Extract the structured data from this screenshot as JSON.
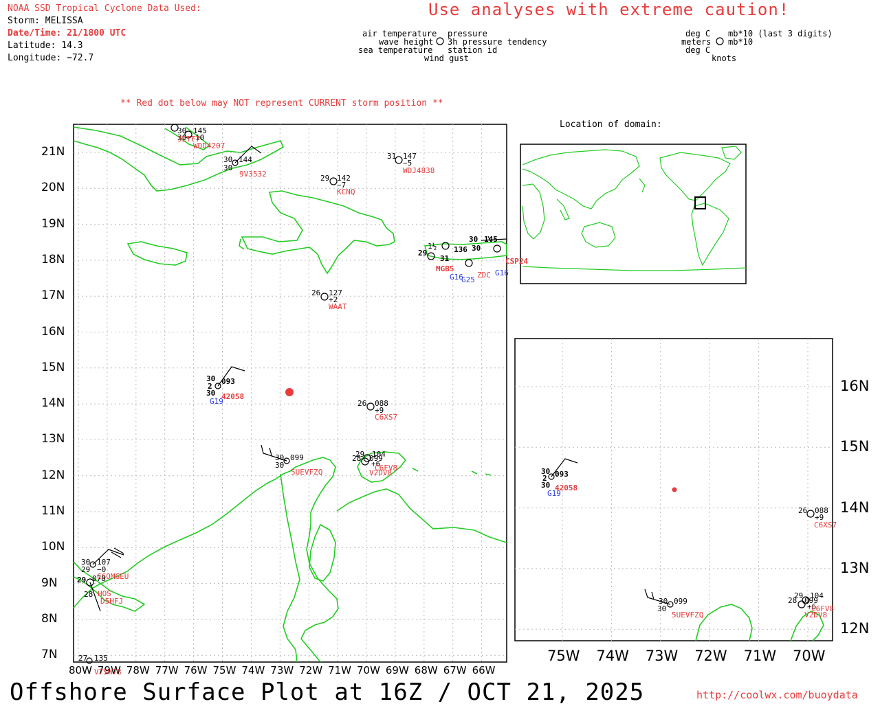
{
  "header": {
    "source": "NOAA SSD Tropical Cyclone Data Used:",
    "storm": "Storm: MELISSA",
    "datetime": "Date/Time: 21/1800 UTC",
    "latitude": "Latitude: 14.3",
    "longitude": "Longitude: −72.7",
    "caution": "Use analyses with extreme caution!",
    "red_dot_note": "** Red dot below may NOT represent CURRENT storm position **"
  },
  "legend": {
    "left": {
      "air_temperature": "air temperature",
      "wave_height": "wave height",
      "sea_temperature": "sea temperature",
      "pressure": "pressure",
      "tendency": "3h pressure tendency",
      "station_id": "station id",
      "wind_gust": "wind gust"
    },
    "right": {
      "deg_c_1": "deg C",
      "meters": "meters",
      "deg_c_2": "deg C",
      "mb1": "mb*10 (last 3 digits)",
      "mb2": "mb*10",
      "knots": "knots"
    }
  },
  "inset": {
    "title": "Location of domain:"
  },
  "main_map": {
    "lat_labels": [
      "21N",
      "20N",
      "19N",
      "18N",
      "17N",
      "16N",
      "15N",
      "14N",
      "13N",
      "12N",
      "11N",
      "10N",
      "9N",
      "8N",
      "7N"
    ],
    "lon_labels": [
      "80W",
      "79W",
      "78W",
      "77W",
      "76W",
      "75W",
      "74W",
      "73W",
      "72W",
      "71W",
      "70W",
      "69W",
      "68W",
      "67W",
      "66W"
    ]
  },
  "zoom_map": {
    "lat_labels": [
      "16N",
      "15N",
      "14N",
      "13N",
      "12N"
    ],
    "lon_labels": [
      "75W",
      "74W",
      "73W",
      "72W",
      "71W",
      "70W"
    ]
  },
  "storm_color": "#e63c3c",
  "land_color": "#22cc22",
  "stations": [
    {
      "id": "WDD4207",
      "vals": [
        "30",
        "145",
        "30",
        "10"
      ]
    },
    {
      "id": "3ETF7",
      "vals": []
    },
    {
      "id": "9V3532",
      "vals": [
        "30",
        "144",
        "30"
      ]
    },
    {
      "id": "KCNQ",
      "vals": [
        "29",
        "142",
        "−7"
      ]
    },
    {
      "id": "WDJ4838",
      "vals": [
        "31",
        "147",
        "−5"
      ]
    },
    {
      "id": "WAAT",
      "vals": [
        "26",
        "127",
        "+2"
      ]
    },
    {
      "id": "42058",
      "vals": [
        "30",
        "093",
        "2",
        "30"
      ]
    },
    {
      "id": "G19",
      "vals": []
    },
    {
      "id": "C6XS7",
      "vals": [
        "26",
        "088",
        "+9"
      ]
    },
    {
      "id": "5UEVFZQ",
      "vals": [
        "30",
        "099",
        "30"
      ]
    },
    {
      "id": "V2DV8",
      "vals": [
        "29",
        "104",
        "28",
        "099",
        "+6"
      ]
    },
    {
      "id": "C6FV8",
      "vals": []
    },
    {
      "id": "C6OMGEU",
      "vals": [
        "30",
        "107",
        "29",
        "−0"
      ]
    },
    {
      "id": "HOS",
      "vals": [
        "29",
        "078",
        "28"
      ]
    },
    {
      "id": "D5HFJ",
      "vals": []
    },
    {
      "id": "V7SW73",
      "vals": [
        "27",
        "135"
      ]
    },
    {
      "id": "CSP24",
      "vals": []
    },
    {
      "id": "136",
      "vals": []
    }
  ],
  "footer": {
    "title": "Offshore Surface Plot at 16Z / OCT 21, 2025",
    "url": "http://coolwx.com/buoydata"
  }
}
